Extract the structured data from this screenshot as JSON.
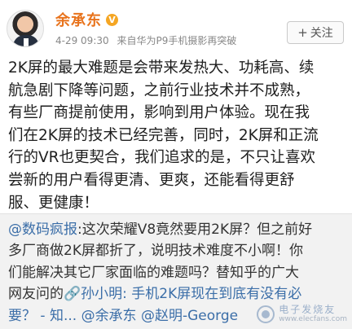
{
  "author": {
    "name": "余承东",
    "verified_icon": "v-verified-icon",
    "time": "4-29 09:30",
    "source": "来自华为P9手机摄影再突破"
  },
  "follow_button": {
    "plus": "+",
    "label": "关注"
  },
  "content_lines": [
    "2K屏的最大难题是会带来发热大、功耗高、续",
    "航急剧下降等问题，之前行业技术并不成熟，",
    "有些厂商提前使用，影响到用户体验。现在我",
    "们在2K屏的技术已经完善，同时，2K屏和正流",
    "行的VR也更契合，我们追求的是，不只让喜欢",
    "尝新的用户看得更清、更爽，还能看得更舒",
    "服、更健康！"
  ],
  "repost": {
    "mention_1": "@数码疯报",
    "line_1_rest": ":这次荣耀V8竟然要用2K屏？但之前好",
    "line_2": "多厂商做2K屏都折了，说明技术难度不小啊！你",
    "line_3": "们能解决其它厂家面临的难题吗？替知乎的广大",
    "line_4_start": "网友问的",
    "link_text": "🔗孙小明: 手机2K屏现在到底有没有必",
    "line_5_link": "要？ - 知...",
    "mention_2": "@余承东",
    "mention_3": "@赵明-George"
  },
  "watermark": {
    "cn": "电子发烧友",
    "en": "www.elecfans.com"
  },
  "colors": {
    "name": "#e8731c",
    "link": "#3b6ea8",
    "repost_bg": "#f2f2f2"
  }
}
